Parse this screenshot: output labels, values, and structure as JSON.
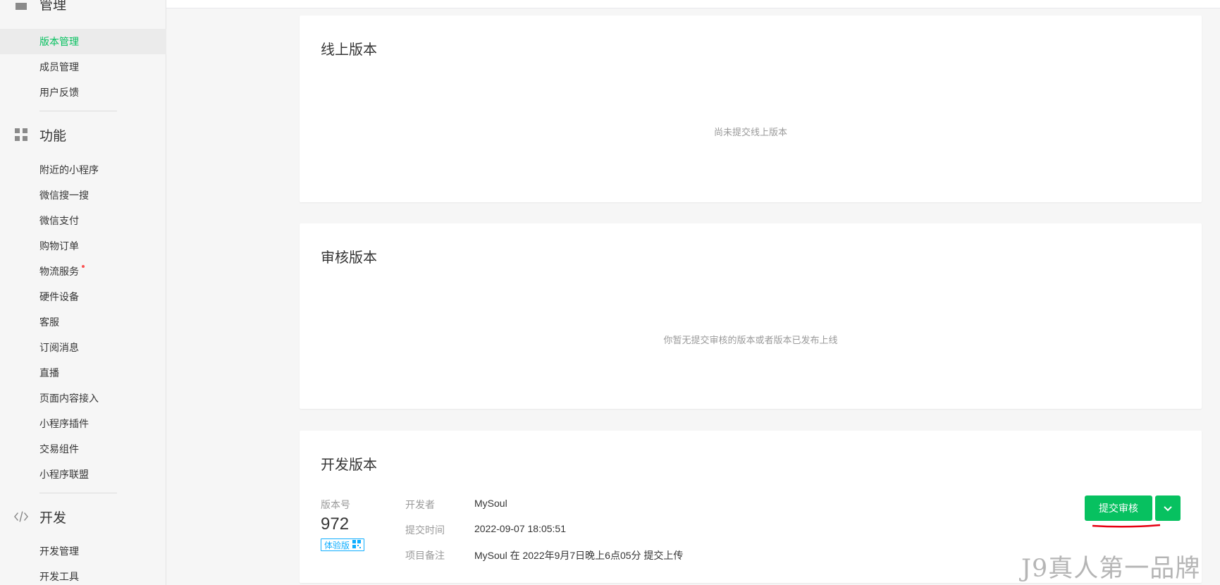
{
  "sidebar": {
    "sections": [
      {
        "title": "管理",
        "icon": "manage-icon",
        "items": [
          {
            "label": "版本管理",
            "active": true
          },
          {
            "label": "成员管理"
          },
          {
            "label": "用户反馈"
          }
        ]
      },
      {
        "title": "功能",
        "icon": "grid-icon",
        "items": [
          {
            "label": "附近的小程序"
          },
          {
            "label": "微信搜一搜"
          },
          {
            "label": "微信支付"
          },
          {
            "label": "购物订单"
          },
          {
            "label": "物流服务",
            "dot": true
          },
          {
            "label": "硬件设备"
          },
          {
            "label": "客服"
          },
          {
            "label": "订阅消息"
          },
          {
            "label": "直播"
          },
          {
            "label": "页面内容接入"
          },
          {
            "label": "小程序插件"
          },
          {
            "label": "交易组件"
          },
          {
            "label": "小程序联盟"
          }
        ]
      },
      {
        "title": "开发",
        "icon": "code-icon",
        "items": [
          {
            "label": "开发管理"
          },
          {
            "label": "开发工具"
          }
        ]
      }
    ]
  },
  "online": {
    "title": "线上版本",
    "empty": "尚未提交线上版本"
  },
  "review": {
    "title": "审核版本",
    "empty": "你暂无提交审核的版本或者版本已发布上线"
  },
  "dev": {
    "title": "开发版本",
    "version_label": "版本号",
    "version": "972",
    "badge": "体验版",
    "developer_label": "开发者",
    "developer": "MySoul",
    "time_label": "提交时间",
    "time": "2022-09-07 18:05:51",
    "note_label": "项目备注",
    "note": "MySoul 在 2022年9月7日晚上6点05分 提交上传",
    "submit_button": "提交审核"
  },
  "watermark": "J9真人第一品牌",
  "colors": {
    "accent": "#07c160",
    "link_blue": "#10aeff",
    "annotation_red": "#e60012"
  }
}
